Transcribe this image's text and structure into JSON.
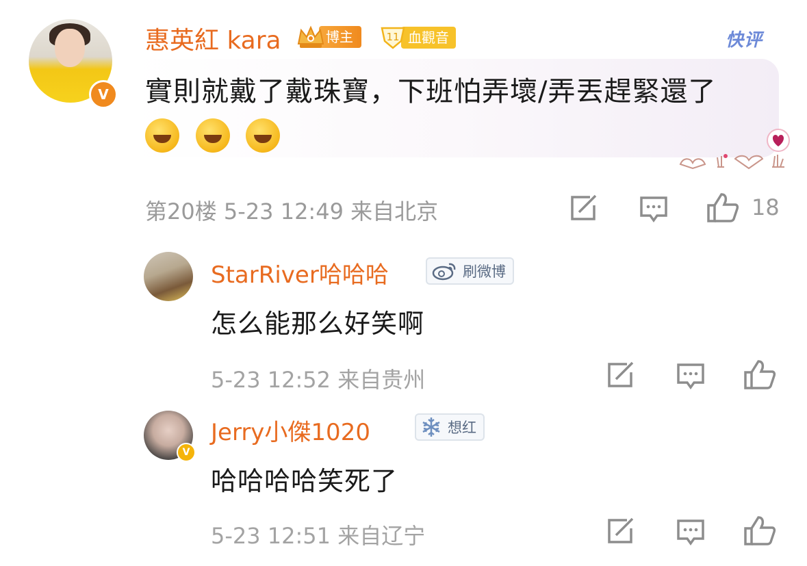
{
  "main_comment": {
    "user_name": "惠英紅 kara",
    "badge_role": "博主",
    "badge_fan_level": "11",
    "badge_fan_label": "血觀音",
    "quick_review_label": "快评",
    "text": "實則就戴了戴珠寶，下班怕弄壞/弄丟趕緊還了",
    "emoji_names": [
      "rofl-emoji",
      "rofl-emoji",
      "rofl-emoji"
    ],
    "floor": "第20楼",
    "timestamp": "5-23 12:49",
    "location": "来自北京",
    "like_count": "18",
    "verified_mark": "V"
  },
  "replies": [
    {
      "user_name": "StarRiver哈哈哈",
      "tag_label": "刷微博",
      "tag_icon": "weibo-icon",
      "text": "怎么能那么好笑啊",
      "timestamp": "5-23 12:52",
      "location": "来自贵州"
    },
    {
      "user_name": "Jerry小傑1020",
      "tag_label": "想红",
      "tag_icon": "snowflake-icon",
      "text": "哈哈哈哈笑死了",
      "timestamp": "5-23 12:51",
      "location": "来自辽宁",
      "verified_mark": "V"
    }
  ],
  "colors": {
    "name_orange": "#e86b20",
    "meta_gray": "#9a9a9a",
    "text_dark": "#1a1a1a",
    "kuaiping_blue": "#6d8ad8",
    "verified_orange": "#f08a1e"
  }
}
